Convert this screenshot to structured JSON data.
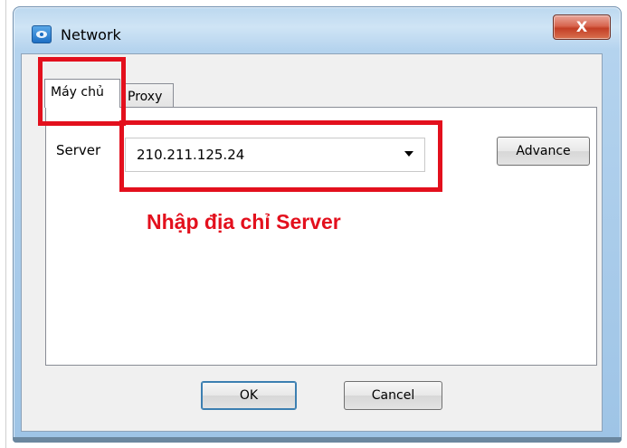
{
  "window": {
    "title": "Network",
    "close_label": "X"
  },
  "tabs": [
    {
      "label": "Máy chủ",
      "active": true
    },
    {
      "label": "Proxy",
      "active": false
    }
  ],
  "server": {
    "label": "Server",
    "value": "210.211.125.24"
  },
  "buttons": {
    "advance": "Advance",
    "ok": "OK",
    "cancel": "Cancel"
  },
  "annotation": {
    "text": "Nhập địa chỉ Server",
    "color": "#e3101d"
  },
  "icons": {
    "app": "network-app-icon",
    "dropdown": "chevron-down-icon"
  }
}
